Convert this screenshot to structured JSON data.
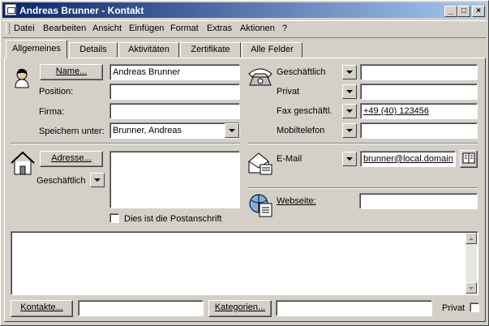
{
  "window": {
    "title": "Andreas Brunner - Kontakt",
    "min_glyph": "_",
    "max_glyph": "□",
    "close_glyph": "×"
  },
  "menu": [
    "Datei",
    "Bearbeiten",
    "Ansicht",
    "Einfügen",
    "Format",
    "Extras",
    "Aktionen",
    "?"
  ],
  "tabs": [
    "Allgemeines",
    "Details",
    "Aktivitäten",
    "Zertifikate",
    "Alle Felder"
  ],
  "general": {
    "name_button": "Name...",
    "name_value": "Andreas Brunner",
    "position_label": "Position:",
    "position_value": "",
    "company_label": "Firma:",
    "company_value": "",
    "file_as_label": "Speichern unter:",
    "file_as_value": "Brunner, Andreas"
  },
  "phones": [
    {
      "label": "Geschäftlich",
      "value": ""
    },
    {
      "label": "Privat",
      "value": ""
    },
    {
      "label": "Fax geschäftl.",
      "value": "+49 (40) 123456"
    },
    {
      "label": "Mobiltelefon",
      "value": ""
    }
  ],
  "address": {
    "button": "Adresse...",
    "type": "Geschäftlich",
    "value": "",
    "mailing_label": "Dies ist die Postanschrift",
    "mailing_checked": false
  },
  "email": {
    "label": "E-Mail",
    "value": "brunner@local.domain"
  },
  "web": {
    "label": "Webseite:",
    "value": ""
  },
  "notes": "",
  "footer": {
    "contacts_button": "Kontakte...",
    "contacts_value": "",
    "categories_button": "Kategorien...",
    "categories_value": "",
    "private_label": "Privat",
    "private_checked": false
  },
  "colors": {
    "title_start": "#0a246a",
    "title_end": "#a6caf0",
    "face": "#d4d0c8"
  }
}
